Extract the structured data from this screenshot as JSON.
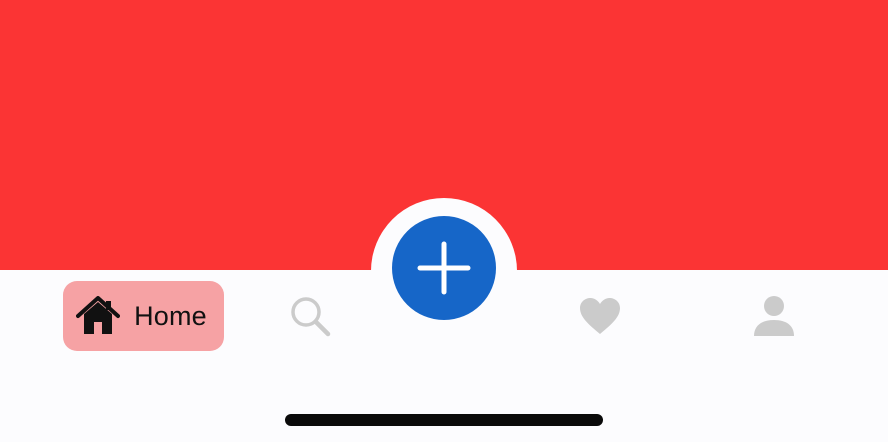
{
  "screen": {
    "content_color": "#fb3434",
    "tab_bar_color": "#fcfcfe"
  },
  "tab_bar": {
    "active_tab_background": "#f6a2a4",
    "inactive_icon_color": "#cbcbcb",
    "tabs": [
      {
        "id": "home",
        "label": "Home",
        "icon": "home-icon",
        "active": true
      },
      {
        "id": "search",
        "icon": "search-icon",
        "active": false
      },
      {
        "id": "favorites",
        "icon": "heart-icon",
        "active": false
      },
      {
        "id": "profile",
        "icon": "user-icon",
        "active": false
      }
    ],
    "fab": {
      "icon": "plus-icon",
      "color": "#1666c8"
    }
  },
  "home_indicator": {
    "color": "#0a0a0a"
  }
}
